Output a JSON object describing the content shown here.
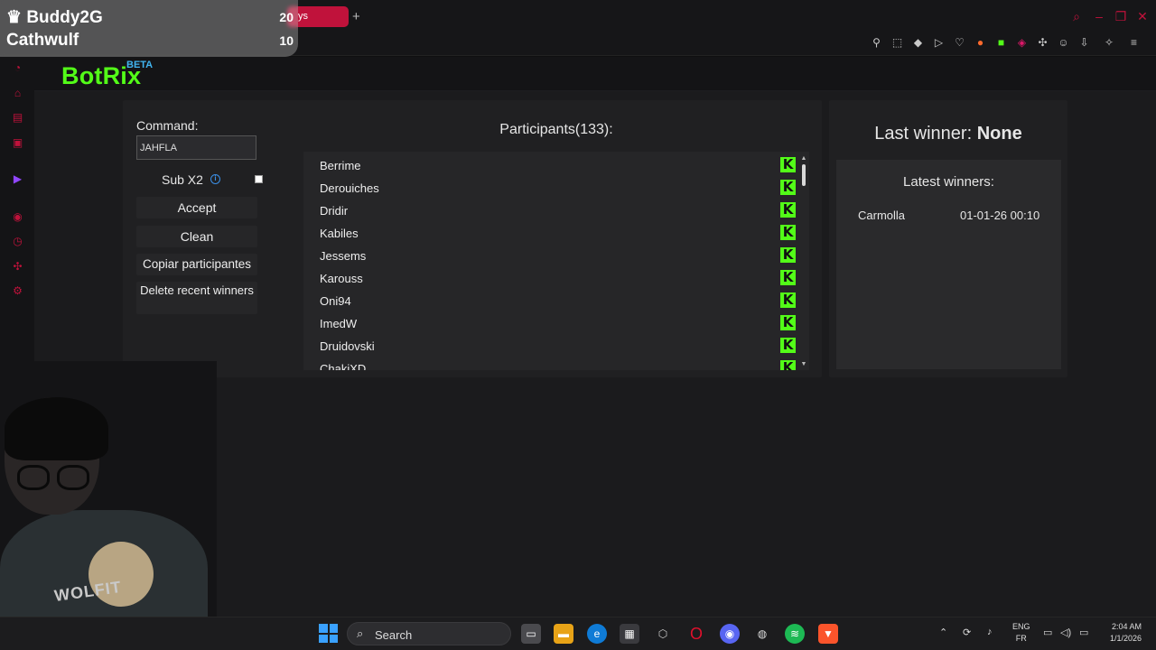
{
  "scoreboard": {
    "rows": [
      {
        "name": "Buddy2G",
        "points": "20"
      },
      {
        "name": "Cathwulf",
        "points": "10"
      }
    ]
  },
  "browser": {
    "tab_label": "ys"
  },
  "app": {
    "logo": "BotRix",
    "badge": "BETA"
  },
  "command": {
    "label": "Command:",
    "value": "JAHFLA"
  },
  "sub_x2": {
    "label": "Sub X2",
    "checked": false
  },
  "buttons": {
    "accept": "Accept",
    "clean": "Clean",
    "copy": "Copiar participantes",
    "delete_recent": "Delete recent winners"
  },
  "participants": {
    "title": "Participants(133):",
    "items": [
      "Berrime",
      "Derouiches",
      "Dridir",
      "Kabiles",
      "Jessems",
      "Karouss",
      "Oni94",
      "ImedW",
      "Druidovski",
      "ChakiXD"
    ]
  },
  "winner": {
    "label": "Last winner:",
    "value": "None",
    "latest_title": "Latest winners:",
    "latest": [
      {
        "name": "Carmolla",
        "date": "01-01-26 00:10"
      }
    ]
  },
  "taskbar": {
    "search": "Search",
    "lang_top": "ENG",
    "lang_bottom": "FR",
    "time": "2:04 AM",
    "date": "1/1/2026"
  },
  "webcam": {
    "shirt_text": "WOLFIT"
  },
  "colors": {
    "accent": "#c0123b",
    "kick_green": "#53fc18",
    "beta_blue": "#41b4f0"
  }
}
